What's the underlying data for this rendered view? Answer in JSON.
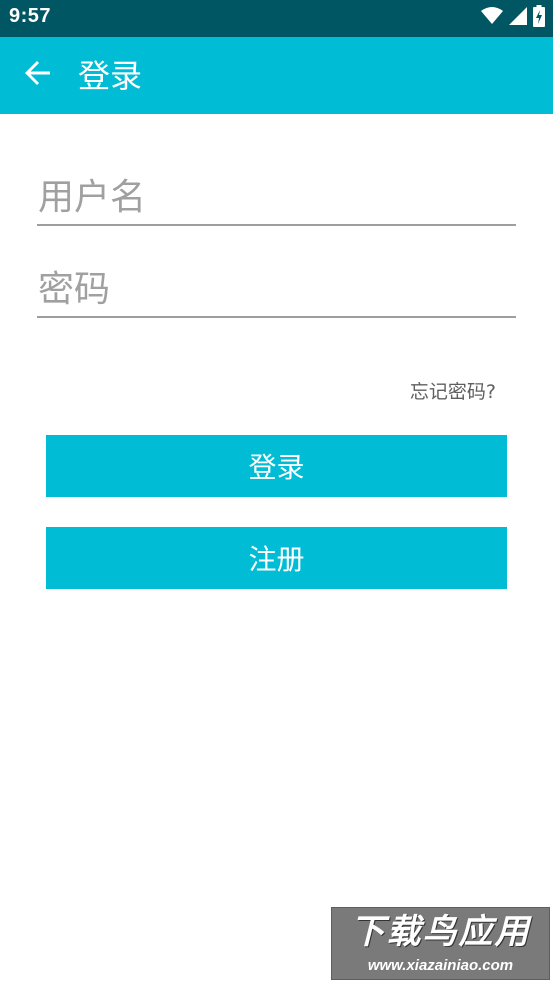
{
  "status_bar": {
    "time": "9:57",
    "icons": [
      "wifi-icon",
      "signal-icon",
      "battery-charging-icon"
    ]
  },
  "app_bar": {
    "title": "登录",
    "back_icon": "arrow-back-icon",
    "color": "#00bcd4"
  },
  "form": {
    "username_placeholder": "用户名",
    "username_value": "",
    "password_placeholder": "密码",
    "password_value": "",
    "forgot_password": "忘记密码?",
    "login_label": "登录",
    "register_label": "注册"
  },
  "watermark": {
    "text": "下载鸟应用",
    "url": "www.xiazainiao.com"
  },
  "colors": {
    "accent": "#00bcd4",
    "status_bar": "#005662",
    "underline": "#9e9e9e"
  }
}
